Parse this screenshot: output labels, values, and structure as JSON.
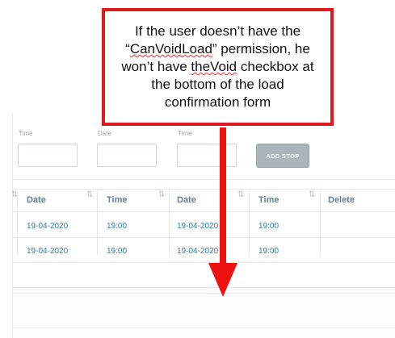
{
  "form": {
    "fields": [
      {
        "label": "Time",
        "value": ""
      },
      {
        "label": "Date",
        "value": ""
      },
      {
        "label": "Time",
        "value": ""
      }
    ],
    "add_stop_label": "ADD STOP"
  },
  "table": {
    "columns": [
      "Date",
      "Time",
      "Date",
      "Time",
      "Delete"
    ],
    "rows": [
      [
        "19-04-2020",
        "19:00",
        "19-04-2020",
        "19:00",
        ""
      ],
      [
        "19-04-2020",
        "19:00",
        "19-04-2020",
        "19:00",
        ""
      ]
    ]
  },
  "callout": {
    "line1": "If the user doesn’t have the",
    "line2_pre": "“",
    "perm": "CanVoidLoad",
    "line2_post": "” permission, he",
    "line3_pre": "won’t have ",
    "the_void": "theVoid",
    "line3_post": " checkbox at",
    "line4": "the bottom of the load",
    "line5": "confirmation form"
  },
  "colors": {
    "callout_border": "#e0191d",
    "arrow": "#ee1111",
    "link_text": "#3a78a6",
    "header_text": "#6a7f8c"
  }
}
